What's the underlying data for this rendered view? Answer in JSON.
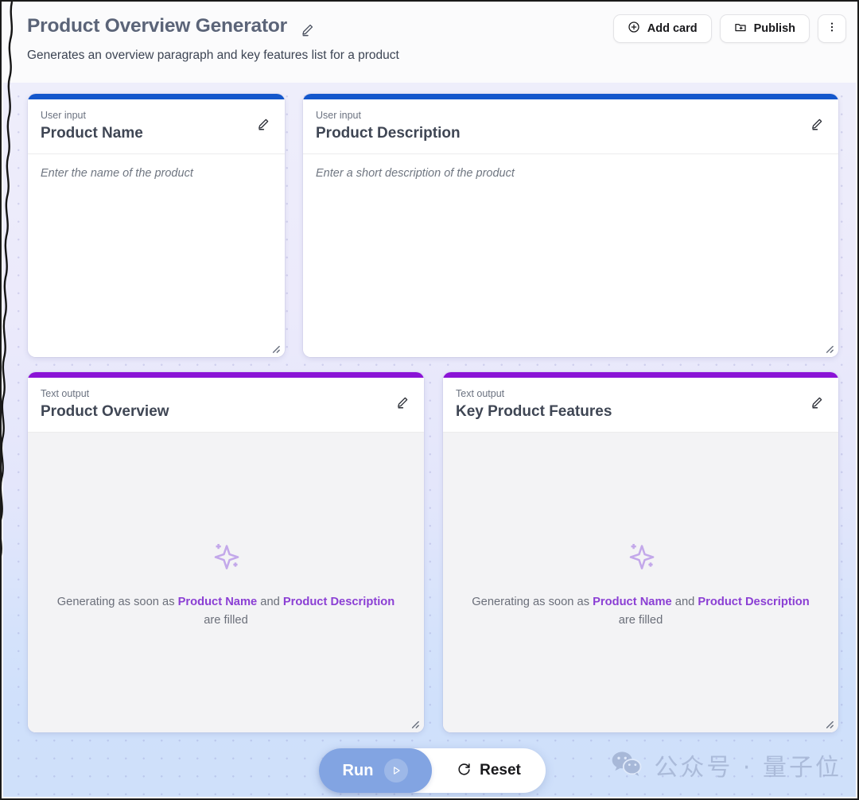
{
  "header": {
    "title": "Product Overview Generator",
    "subtitle": "Generates an overview paragraph and key features list for a product",
    "edit_icon": "pencil-icon",
    "actions": [
      {
        "label": "Add card",
        "icon": "plus-circle-icon"
      },
      {
        "label": "Publish",
        "icon": "publish-folder-icon"
      },
      {
        "label": "",
        "icon": "more-vertical-icon"
      }
    ]
  },
  "cards": [
    {
      "kicker": "User input",
      "title": "Product Name",
      "placeholder": "Enter the name of the product",
      "accent_color": "#1457cc",
      "type": "input"
    },
    {
      "kicker": "User input",
      "title": "Product Description",
      "placeholder": "Enter a short description of the product",
      "accent_color": "#1457cc",
      "type": "input"
    },
    {
      "kicker": "Text output",
      "title": "Product Overview",
      "accent_color": "#8a13d6",
      "type": "output",
      "message": {
        "prefix": "Generating as soon as ",
        "ref1": "Product Name",
        "middle": " and ",
        "ref2": "Product Description",
        "suffix": " are filled"
      },
      "icon": "sparkle-icon"
    },
    {
      "kicker": "Text output",
      "title": "Key Product Features",
      "accent_color": "#8a13d6",
      "type": "output",
      "message": {
        "prefix": "Generating as soon as ",
        "ref1": "Product Name",
        "middle": " and ",
        "ref2": "Product Description",
        "suffix": " are filled"
      },
      "icon": "sparkle-icon"
    }
  ],
  "run_bar": {
    "run_label": "Run",
    "run_icon": "play-icon",
    "reset_label": "Reset",
    "reset_icon": "refresh-icon",
    "run_color": "#82a4e2"
  },
  "watermark": {
    "text": "公众号 · 量子位",
    "icon": "wechat-icon"
  },
  "theme": {
    "input_accent": "#1457cc",
    "output_accent": "#8a13d6",
    "reference_text": "#8b3fd4",
    "canvas_top": "#eeeefb",
    "canvas_bottom": "#cfe0fa"
  }
}
